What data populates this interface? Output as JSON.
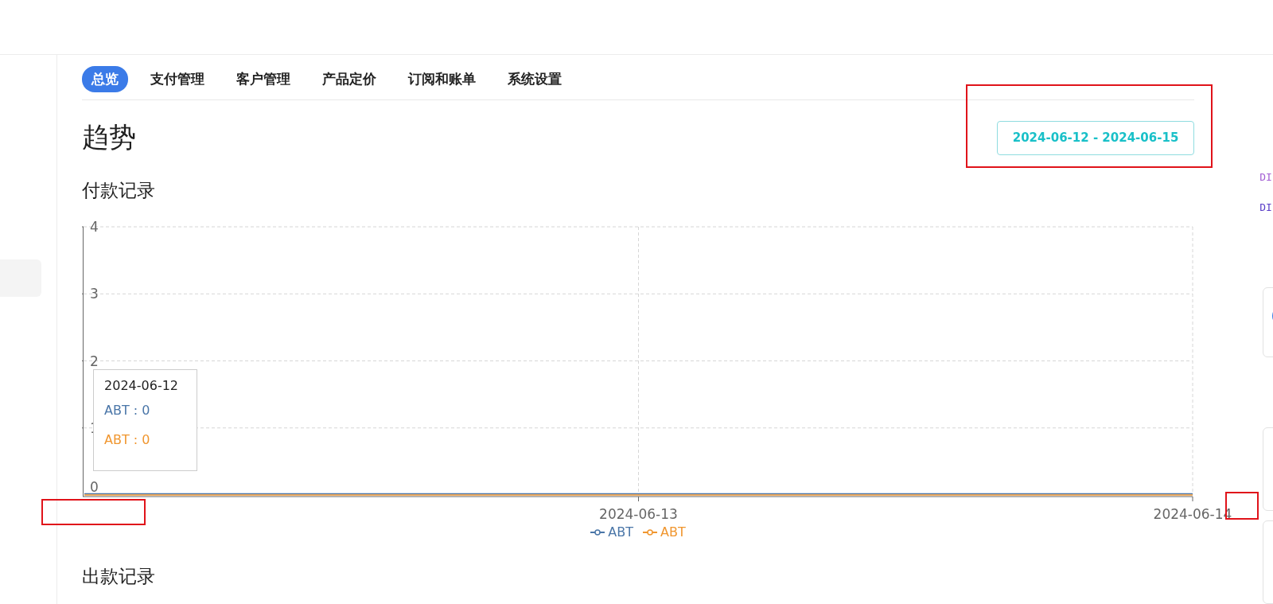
{
  "tabs": [
    {
      "label": "总览",
      "selected": true
    },
    {
      "label": "支付管理",
      "selected": false
    },
    {
      "label": "客户管理",
      "selected": false
    },
    {
      "label": "产品定价",
      "selected": false
    },
    {
      "label": "订阅和账单",
      "selected": false
    },
    {
      "label": "系统设置",
      "selected": false
    }
  ],
  "trend": {
    "title": "趋势",
    "date_range": "2024-06-12 - 2024-06-15",
    "payments": {
      "title": "付款记录",
      "chart_data": {
        "type": "line",
        "categories": [
          null,
          "2024-06-13",
          "2024-06-14"
        ],
        "yticks": [
          0,
          1,
          2,
          3,
          4
        ],
        "ylim": [
          0,
          4
        ],
        "grid": true,
        "series": [
          {
            "name": "ABT",
            "color": "#4a76a8",
            "values": [
              0,
              0,
              0
            ]
          },
          {
            "name": "ABT",
            "color": "#f0962f",
            "values": [
              0,
              0,
              0
            ]
          }
        ]
      },
      "tooltip": {
        "title": "2024-06-12",
        "rows": [
          {
            "text": "ABT : 0",
            "color": "#4a76a8"
          },
          {
            "text": "ABT : 0",
            "color": "#f0962f"
          }
        ]
      }
    },
    "withdrawals": {
      "title": "出款记录"
    }
  },
  "right_panel": {
    "codes": [
      {
        "text": "DI",
        "color": "#a35fd4"
      },
      {
        "text": "DI",
        "color": "#5a3ec8"
      }
    ],
    "cards": [
      {
        "kind": "icon-card"
      },
      {
        "kind": "plain-card"
      },
      {
        "kind": "plain-card"
      }
    ]
  },
  "annotation_boxes": [
    {
      "kind": "date-range"
    },
    {
      "kind": "axis-origin"
    },
    {
      "kind": "right-gap"
    }
  ]
}
